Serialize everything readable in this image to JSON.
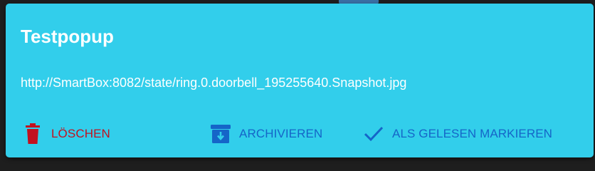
{
  "popup": {
    "title": "Testpopup",
    "message": "http://SmartBox:8082/state/ring.0.doorbell_195255640.Snapshot.jpg",
    "background_color": "#32ceeb"
  },
  "actions": {
    "delete_label": "LÖSCHEN",
    "delete_icon": "trash-icon",
    "delete_color": "#c2111f",
    "archive_label": "ARCHIVIEREN",
    "archive_icon": "archive-icon",
    "archive_color": "#1565c8",
    "mark_read_label": "ALS GELESEN MARKIEREN",
    "mark_read_icon": "check-icon",
    "mark_read_color": "#1565c8"
  }
}
